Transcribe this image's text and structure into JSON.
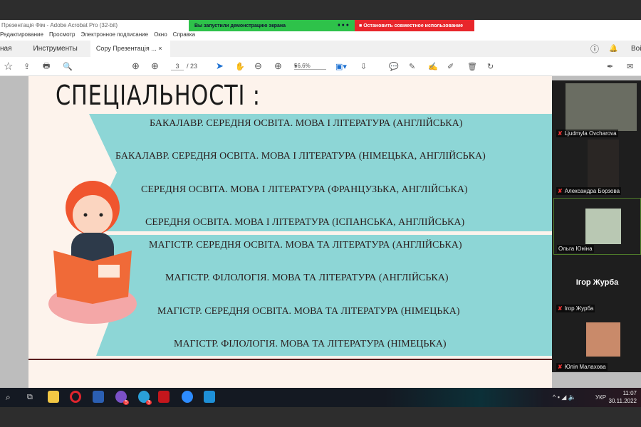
{
  "window": {
    "title": "Презентація Фім - Adobe Acrobat Pro (32-bit)"
  },
  "share": {
    "status": "Вы запустили демонстрацию экрана",
    "stop": "Остановить совместное использование"
  },
  "menu": [
    "Редактирование",
    "Просмотр",
    "Электронное подписание",
    "Окно",
    "Справка"
  ],
  "tabs": {
    "home": "ная",
    "tools": "Инструменты",
    "doc": "Copy Презентація ...",
    "close": "×",
    "signin": "Вой"
  },
  "toolbar": {
    "page": "3",
    "total": "/ 23",
    "zoom": "56,6%"
  },
  "slide": {
    "heading": "СПЕЦІАЛЬНОСТІ :",
    "rows": [
      "БАКАЛАВР. СЕРЕДНЯ ОСВІТА. МОВА І ЛІТЕРАТУРА  (АНГЛІЙСЬКА)",
      "БАКАЛАВР. СЕРЕДНЯ ОСВІТА. МОВА І ЛІТЕРАТУРА  (НІМЕЦЬКА, АНГЛІЙСЬКА)",
      "СЕРЕДНЯ ОСВІТА. МОВА І ЛІТЕРАТУРА  (ФРАНЦУЗЬКА, АНГЛІЙСЬКА)",
      "СЕРЕДНЯ ОСВІТА. МОВА І ЛІТЕРАТУРА  (ІСПАНСЬКА, АНГЛІЙСЬКА)",
      "МАГІСТР.  СЕРЕДНЯ ОСВІТА. МОВА ТА ЛІТЕРАТУРА (АНГЛІЙСЬКА)",
      "МАГІСТР. ФІЛОЛОГІЯ.  МОВА ТА ЛІТЕРАТУРА (АНГЛІЙСЬКА)",
      "МАГІСТР. СЕРЕДНЯ ОСВІТА. МОВА ТА ЛІТЕРАТУРА (НІМЕЦЬКА)",
      "МАГІСТР. ФІЛОЛОГІЯ. МОВА ТА ЛІТЕРАТУРА (НІМЕЦЬКА)"
    ]
  },
  "participants": [
    {
      "name": "Ljudmyla Ovcharova"
    },
    {
      "name": "Александра Борзова"
    },
    {
      "name": "Ольга Юніна"
    },
    {
      "name": "Ігор Журба",
      "label": "Ігор Журба"
    },
    {
      "name": "Юлія Малахова"
    }
  ],
  "tray": {
    "lang": "УКР",
    "time": "11:07",
    "date": "30.11.2022"
  },
  "taskbar_badges": {
    "viber": "5",
    "telegram": "3"
  }
}
